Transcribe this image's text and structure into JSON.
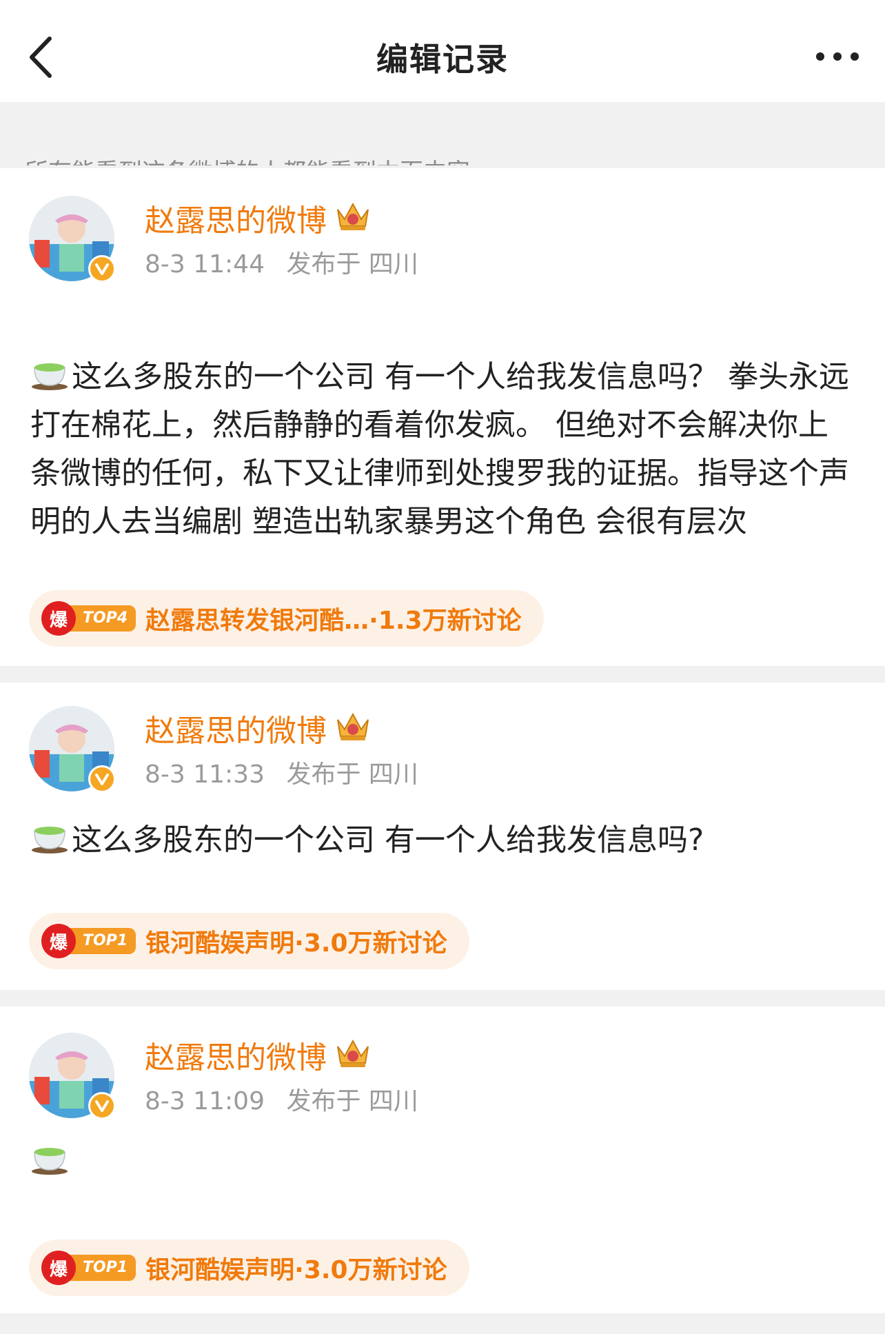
{
  "header": {
    "title": "编辑记录"
  },
  "notice": "所有能看到这条微博的人都能看到本页内容",
  "posts": [
    {
      "author": "赵露思的微博",
      "date": "8-3 11:44",
      "location": "发布于 四川",
      "text": "这么多股东的一个公司 有一个人给我发信息吗？ 拳头永远打在棉花上，然后静静的看着你发疯。 但绝对不会解决你上条微博的任何，私下又让律师到处搜罗我的证据。指导这个声明的人去当编剧 塑造出轨家暴男这个角色 会很有层次",
      "topic": {
        "badge": "爆",
        "rank": "TOP4",
        "title": "赵露思转发银河酷…",
        "count": "·1.3万新讨论"
      }
    },
    {
      "author": "赵露思的微博",
      "date": "8-3 11:33",
      "location": "发布于 四川",
      "text": "这么多股东的一个公司 有一个人给我发信息吗?",
      "topic": {
        "badge": "爆",
        "rank": "TOP1",
        "title": "银河酷娱声明",
        "count": "·3.0万新讨论"
      }
    },
    {
      "author": "赵露思的微博",
      "date": "8-3 11:09",
      "location": "发布于 四川",
      "text": "",
      "topic": {
        "badge": "爆",
        "rank": "TOP1",
        "title": "银河酷娱声明",
        "count": "·3.0万新讨论"
      }
    }
  ],
  "icons": {
    "back": "chevron-left-icon",
    "more": "more-dots-icon",
    "crown": "crown-icon",
    "verified": "verified-v-icon",
    "tea": "green-tea-emoji-icon",
    "hot": "bao-hot-icon"
  },
  "colors": {
    "accent": "#f07a0c",
    "hot_red": "#e02020",
    "rank_orange": "#f59a23",
    "pill_bg": "#fdf1e6"
  }
}
